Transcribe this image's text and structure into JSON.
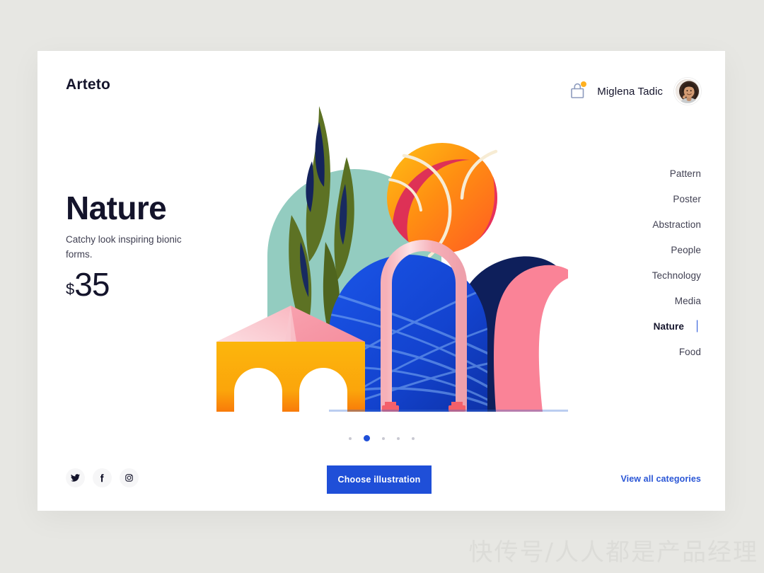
{
  "brand": {
    "name": "Arteto",
    "accent": "#1f4fd8",
    "link_color": "#2a56d6"
  },
  "header": {
    "bag_icon": "shopping-bag-icon",
    "bag_badge_color": "#ffb020",
    "user_name": "Miglena Tadic",
    "avatar_icon": "user-avatar"
  },
  "hero": {
    "title": "Nature",
    "subtitle": "Catchy look inspiring bionic forms.",
    "currency": "$",
    "price": "35"
  },
  "categories": [
    {
      "label": "Pattern",
      "active": false
    },
    {
      "label": "Poster",
      "active": false
    },
    {
      "label": "Abstraction",
      "active": false
    },
    {
      "label": "People",
      "active": false
    },
    {
      "label": "Technology",
      "active": false
    },
    {
      "label": "Media",
      "active": false
    },
    {
      "label": "Nature",
      "active": true
    },
    {
      "label": "Food",
      "active": false
    }
  ],
  "carousel": {
    "total": 5,
    "active_index": 1
  },
  "socials": [
    {
      "name": "twitter-icon",
      "glyph": "twitter"
    },
    {
      "name": "facebook-icon",
      "glyph": "facebook"
    },
    {
      "name": "instagram-icon",
      "glyph": "instagram"
    }
  ],
  "footer": {
    "cta_label": "Choose illustration",
    "view_all_label": "View all categories"
  },
  "illustration": {
    "name": "nature-abstract-illustration",
    "colors": {
      "mint_dome": "#93ccc0",
      "ball_orange": "#ff8c1a",
      "ball_yellow": "#ffb300",
      "ball_red": "#f0434f",
      "ball_line": "#f7ecd4",
      "leaf_olive": "#5d7224",
      "leaf_dark": "#14235c",
      "blue_dome": "#1446d6",
      "navy_wave": "#0e1f5b",
      "pink_wave": "#fa8397",
      "pink_arch": "#f7b9bf",
      "pink_arch_light": "#fbdde0",
      "arch_base_red": "#f4606a",
      "yellow_block": "#fbb60c",
      "yellow_block_low": "#f98b0a",
      "pyramid_pink": "#f9a9b4",
      "pyramid_pink_light": "#fbd3d8",
      "teal_strip": "#7fb7ae"
    }
  },
  "watermark": {
    "text": "快传号/人人都是产品经理"
  }
}
